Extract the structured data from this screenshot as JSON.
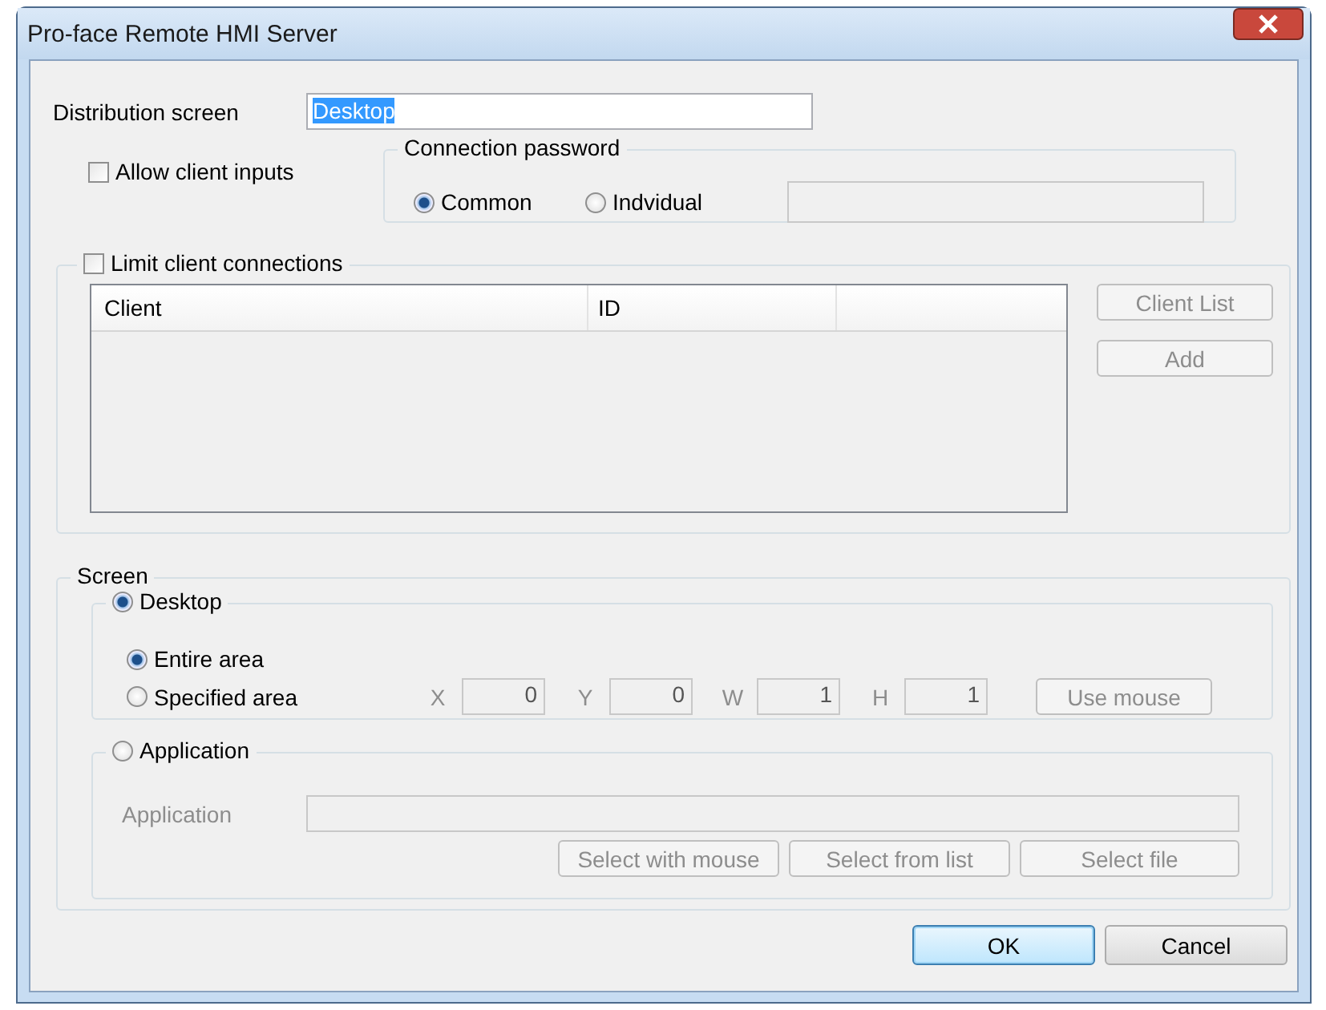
{
  "window": {
    "title": "Pro-face Remote HMI Server"
  },
  "distribution": {
    "label": "Distribution screen",
    "value": "Desktop",
    "highlighted": true
  },
  "allow_client_inputs": {
    "label": "Allow client inputs",
    "checked": false
  },
  "connection_password": {
    "title": "Connection password",
    "options": [
      {
        "label": "Common",
        "selected": true
      },
      {
        "label": "Indvidual",
        "selected": false
      }
    ],
    "field_disabled": true
  },
  "limit_client_connections": {
    "label": "Limit client connections",
    "checked": false,
    "columns": [
      "Client",
      "ID"
    ],
    "buttons": [
      {
        "label": "Client List",
        "disabled": true
      },
      {
        "label": "Add",
        "disabled": true
      }
    ]
  },
  "screen": {
    "title": "Screen",
    "desktop": {
      "label": "Desktop",
      "selected": true,
      "areas": [
        {
          "label": "Entire area",
          "selected": true
        },
        {
          "label": "Specified area",
          "selected": false
        }
      ],
      "coords_disabled": true,
      "coords": [
        {
          "label": "X",
          "value": "0"
        },
        {
          "label": "Y",
          "value": "0"
        },
        {
          "label": "W",
          "value": "1"
        },
        {
          "label": "H",
          "value": "1"
        }
      ],
      "use_mouse": {
        "label": "Use mouse",
        "disabled": true
      }
    },
    "application": {
      "label": "Application",
      "selected": false,
      "field_label": "Application",
      "disabled": true,
      "buttons": [
        {
          "label": "Select with mouse",
          "disabled": true
        },
        {
          "label": "Select from list",
          "disabled": true
        },
        {
          "label": "Select file",
          "disabled": true
        }
      ]
    }
  },
  "buttons": [
    {
      "label": "OK",
      "default": true
    },
    {
      "label": "Cancel",
      "default": false
    }
  ]
}
